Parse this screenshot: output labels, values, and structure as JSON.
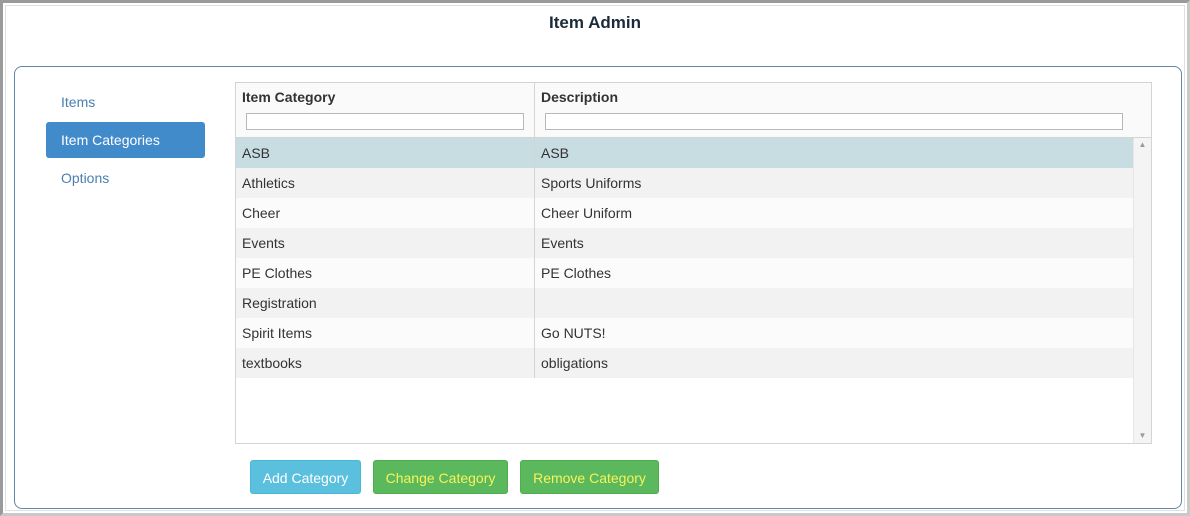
{
  "app": {
    "title": "Item Admin"
  },
  "nav": {
    "items": [
      {
        "label": "Items",
        "active": false
      },
      {
        "label": "Item Categories",
        "active": true
      },
      {
        "label": "Options",
        "active": false
      }
    ]
  },
  "grid": {
    "columns": [
      {
        "header": "Item Category",
        "filter_value": ""
      },
      {
        "header": "Description",
        "filter_value": ""
      }
    ],
    "rows": [
      {
        "category": "ASB",
        "description": "ASB",
        "selected": true
      },
      {
        "category": "Athletics",
        "description": "Sports Uniforms"
      },
      {
        "category": "Cheer",
        "description": "Cheer Uniform"
      },
      {
        "category": "Events",
        "description": "Events"
      },
      {
        "category": "PE Clothes",
        "description": "PE Clothes"
      },
      {
        "category": "Registration",
        "description": ""
      },
      {
        "category": "Spirit Items",
        "description": "Go NUTS!"
      },
      {
        "category": "textbooks",
        "description": "obligations"
      }
    ]
  },
  "actions": {
    "add_label": "Add Category",
    "change_label": "Change Category",
    "remove_label": "Remove Category"
  },
  "colors": {
    "nav_active_bg": "#428bca",
    "selected_row_bg": "#c7dde1",
    "add_button_bg": "#5bc0de",
    "success_button_bg": "#5cb85c",
    "success_button_text": "#f7f35a"
  }
}
